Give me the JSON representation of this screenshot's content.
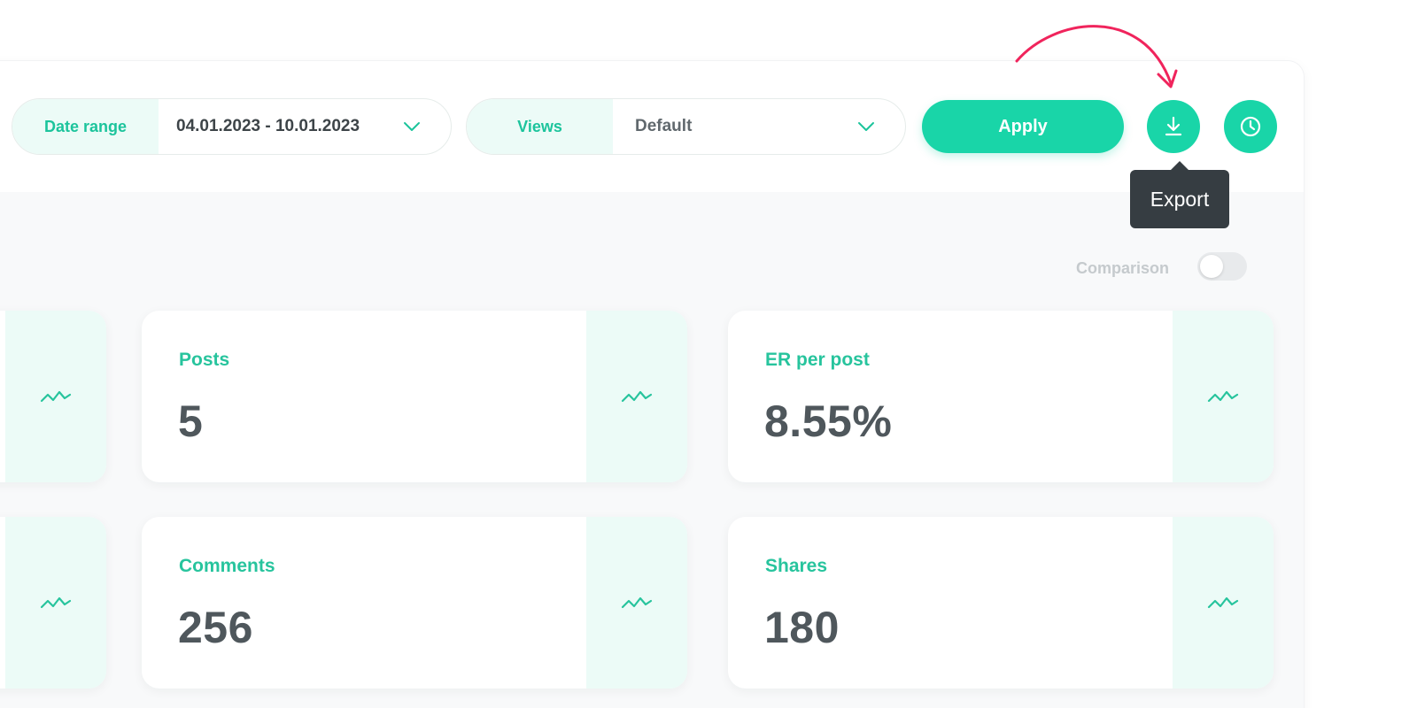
{
  "filters": {
    "date_range": {
      "label": "Date range",
      "value": "04.01.2023 - 10.01.2023"
    },
    "views": {
      "label": "Views",
      "value": "Default"
    }
  },
  "toolbar": {
    "apply_label": "Apply",
    "export_icon": "download-icon",
    "history_icon": "clock-icon"
  },
  "tooltip": {
    "text": "Export"
  },
  "comparison": {
    "label": "Comparison",
    "enabled": false
  },
  "metrics": [
    {
      "label": "",
      "value": "",
      "icon": "trend-icon"
    },
    {
      "label": "Posts",
      "value": "5",
      "icon": "trend-icon"
    },
    {
      "label": "ER per post",
      "value": "8.55%",
      "icon": "trend-icon"
    },
    {
      "label": "",
      "value": "",
      "icon": "trend-icon"
    },
    {
      "label": "Comments",
      "value": "256",
      "icon": "trend-icon"
    },
    {
      "label": "Shares",
      "value": "180",
      "icon": "trend-icon"
    }
  ],
  "colors": {
    "accent": "#19d5a8",
    "accent_text": "#1cc49c",
    "accent_light": "#ecfbf7",
    "annotation": "#f0245c",
    "tooltip_bg": "#363d42",
    "value_text": "#4f575c"
  }
}
